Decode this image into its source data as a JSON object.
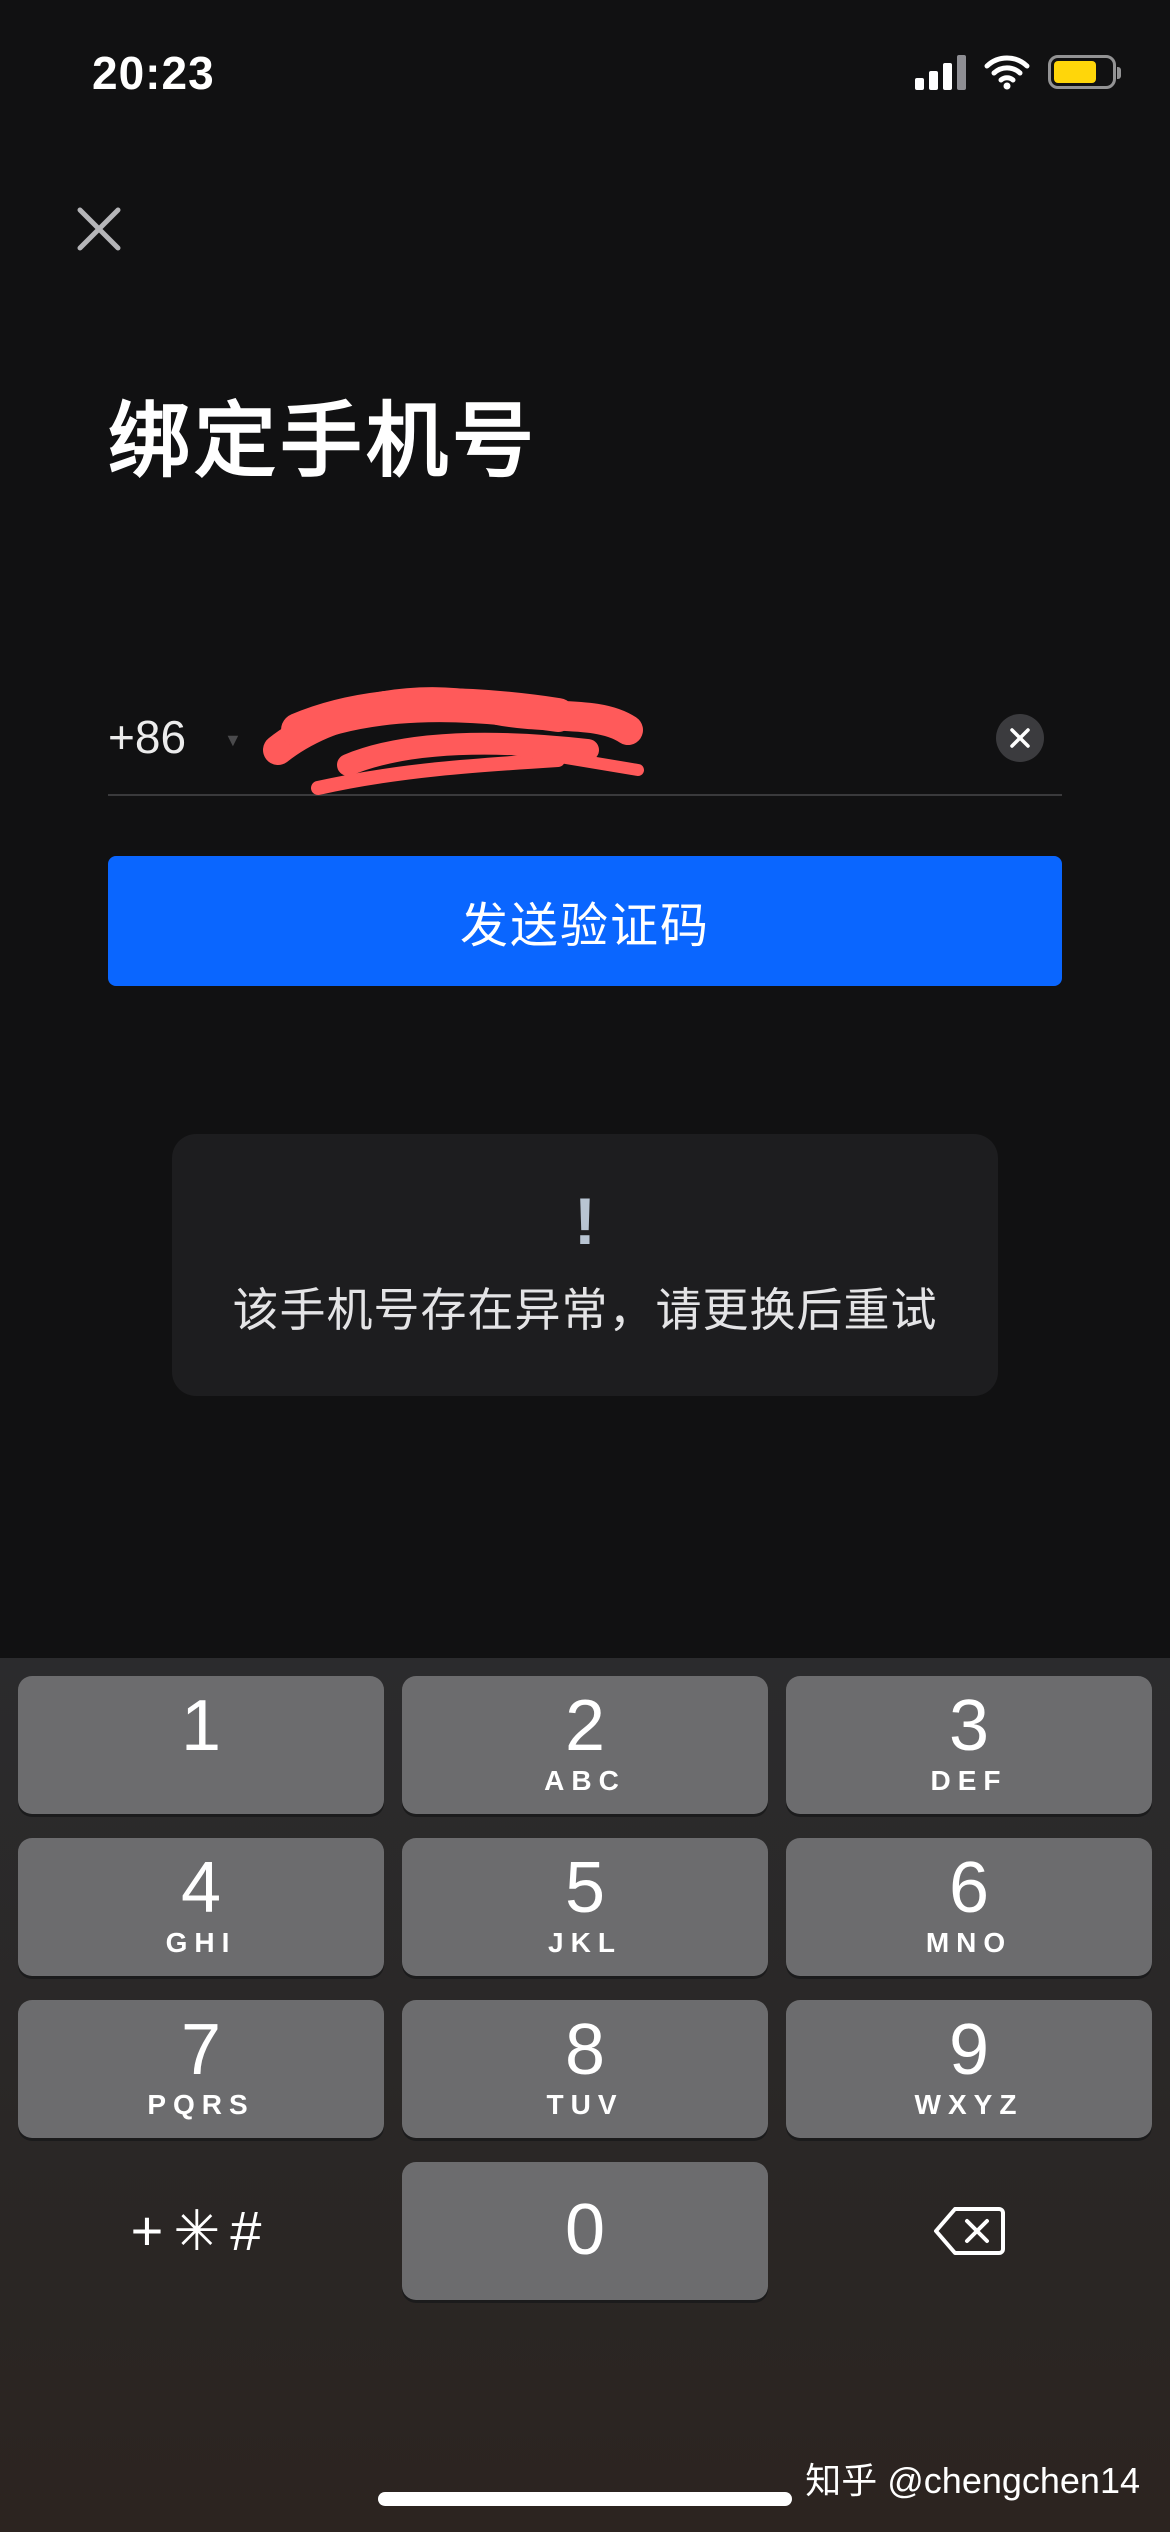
{
  "status_bar": {
    "time": "20:23",
    "battery_level": 0.75,
    "battery_color": "#ffd60a"
  },
  "header": {
    "close_icon": "close-icon",
    "title": "绑定手机号"
  },
  "phone_field": {
    "country_code": "+86",
    "value": "",
    "clear_icon": "clear-icon"
  },
  "send_button": {
    "label": "发送验证码",
    "color": "#0a66ff"
  },
  "toast": {
    "icon": "!",
    "message": "该手机号存在异常，请更换后重试"
  },
  "keypad": {
    "keys": [
      {
        "digit": "1",
        "letters": ""
      },
      {
        "digit": "2",
        "letters": "ABC"
      },
      {
        "digit": "3",
        "letters": "DEF"
      },
      {
        "digit": "4",
        "letters": "GHI"
      },
      {
        "digit": "5",
        "letters": "JKL"
      },
      {
        "digit": "6",
        "letters": "MNO"
      },
      {
        "digit": "7",
        "letters": "PQRS"
      },
      {
        "digit": "8",
        "letters": "TUV"
      },
      {
        "digit": "9",
        "letters": "WXYZ"
      },
      {
        "digit": "0",
        "letters": ""
      }
    ],
    "symbols_label": "+✳#",
    "delete_icon": "backspace-icon"
  },
  "watermark": "知乎 @chengchen14"
}
